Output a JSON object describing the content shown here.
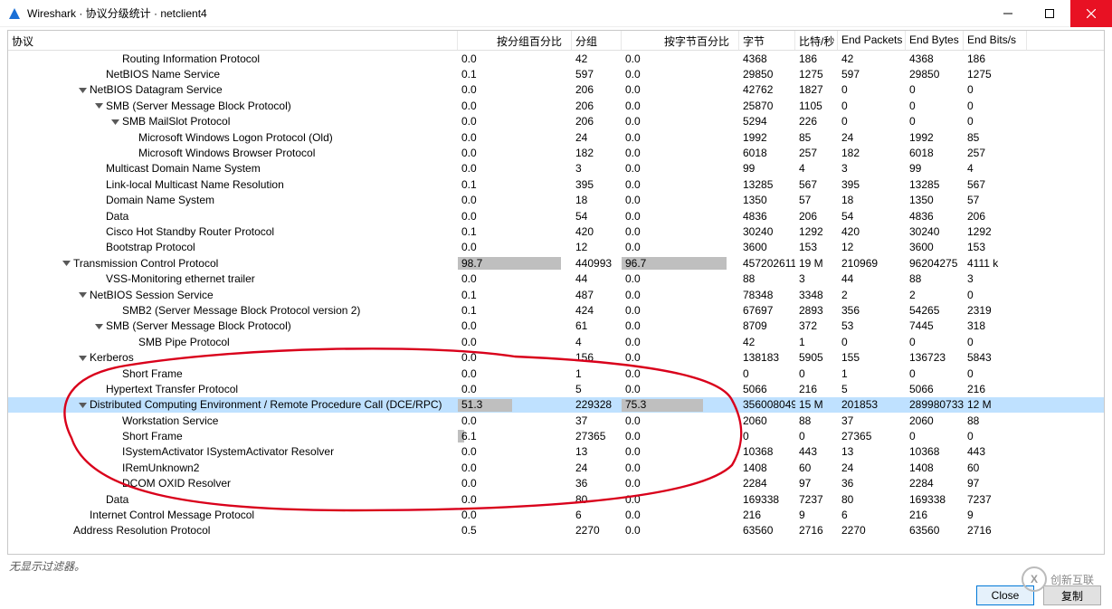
{
  "window": {
    "title": "Wireshark · 协议分级统计 · netclient4"
  },
  "headers": {
    "protocol": "协议",
    "pct_packets": "按分组百分比",
    "packets": "分组",
    "pct_bytes": "按字节百分比",
    "bytes": "字节",
    "bits_s": "比特/秒",
    "end_packets": "End Packets",
    "end_bytes": "End Bytes",
    "end_bits_s": "End Bits/s"
  },
  "rows": [
    {
      "indent": 6,
      "exp": "",
      "name": "Routing Information Protocol",
      "pp": "0.0",
      "pk": "42",
      "pb": "0.0",
      "by": "4368",
      "bs": "186",
      "ep": "42",
      "eb": "4368",
      "ebs": "186"
    },
    {
      "indent": 5,
      "exp": "",
      "name": "NetBIOS Name Service",
      "pp": "0.1",
      "pk": "597",
      "pb": "0.0",
      "by": "29850",
      "bs": "1275",
      "ep": "597",
      "eb": "29850",
      "ebs": "1275"
    },
    {
      "indent": 4,
      "exp": "v",
      "name": "NetBIOS Datagram Service",
      "pp": "0.0",
      "pk": "206",
      "pb": "0.0",
      "by": "42762",
      "bs": "1827",
      "ep": "0",
      "eb": "0",
      "ebs": "0"
    },
    {
      "indent": 5,
      "exp": "v",
      "name": "SMB (Server Message Block Protocol)",
      "pp": "0.0",
      "pk": "206",
      "pb": "0.0",
      "by": "25870",
      "bs": "1105",
      "ep": "0",
      "eb": "0",
      "ebs": "0"
    },
    {
      "indent": 6,
      "exp": "v",
      "name": "SMB MailSlot Protocol",
      "pp": "0.0",
      "pk": "206",
      "pb": "0.0",
      "by": "5294",
      "bs": "226",
      "ep": "0",
      "eb": "0",
      "ebs": "0"
    },
    {
      "indent": 7,
      "exp": "",
      "name": "Microsoft Windows Logon Protocol (Old)",
      "pp": "0.0",
      "pk": "24",
      "pb": "0.0",
      "by": "1992",
      "bs": "85",
      "ep": "24",
      "eb": "1992",
      "ebs": "85"
    },
    {
      "indent": 7,
      "exp": "",
      "name": "Microsoft Windows Browser Protocol",
      "pp": "0.0",
      "pk": "182",
      "pb": "0.0",
      "by": "6018",
      "bs": "257",
      "ep": "182",
      "eb": "6018",
      "ebs": "257"
    },
    {
      "indent": 5,
      "exp": "",
      "name": "Multicast Domain Name System",
      "pp": "0.0",
      "pk": "3",
      "pb": "0.0",
      "by": "99",
      "bs": "4",
      "ep": "3",
      "eb": "99",
      "ebs": "4"
    },
    {
      "indent": 5,
      "exp": "",
      "name": "Link-local Multicast Name Resolution",
      "pp": "0.1",
      "pk": "395",
      "pb": "0.0",
      "by": "13285",
      "bs": "567",
      "ep": "395",
      "eb": "13285",
      "ebs": "567"
    },
    {
      "indent": 5,
      "exp": "",
      "name": "Domain Name System",
      "pp": "0.0",
      "pk": "18",
      "pb": "0.0",
      "by": "1350",
      "bs": "57",
      "ep": "18",
      "eb": "1350",
      "ebs": "57"
    },
    {
      "indent": 5,
      "exp": "",
      "name": "Data",
      "pp": "0.0",
      "pk": "54",
      "pb": "0.0",
      "by": "4836",
      "bs": "206",
      "ep": "54",
      "eb": "4836",
      "ebs": "206"
    },
    {
      "indent": 5,
      "exp": "",
      "name": "Cisco Hot Standby Router Protocol",
      "pp": "0.1",
      "pk": "420",
      "pb": "0.0",
      "by": "30240",
      "bs": "1292",
      "ep": "420",
      "eb": "30240",
      "ebs": "1292"
    },
    {
      "indent": 5,
      "exp": "",
      "name": "Bootstrap Protocol",
      "pp": "0.0",
      "pk": "12",
      "pb": "0.0",
      "by": "3600",
      "bs": "153",
      "ep": "12",
      "eb": "3600",
      "ebs": "153"
    },
    {
      "indent": 3,
      "exp": "v",
      "name": "Transmission Control Protocol",
      "pp": "98.7",
      "pk": "440993",
      "pb": "96.7",
      "by": "457202611",
      "bs": "19 M",
      "ep": "210969",
      "eb": "96204275",
      "ebs": "4111 k",
      "bar_pp": 98.7,
      "bar_pb": 96.7
    },
    {
      "indent": 5,
      "exp": "",
      "name": "VSS-Monitoring ethernet trailer",
      "pp": "0.0",
      "pk": "44",
      "pb": "0.0",
      "by": "88",
      "bs": "3",
      "ep": "44",
      "eb": "88",
      "ebs": "3"
    },
    {
      "indent": 4,
      "exp": "v",
      "name": "NetBIOS Session Service",
      "pp": "0.1",
      "pk": "487",
      "pb": "0.0",
      "by": "78348",
      "bs": "3348",
      "ep": "2",
      "eb": "2",
      "ebs": "0"
    },
    {
      "indent": 6,
      "exp": "",
      "name": "SMB2 (Server Message Block Protocol version 2)",
      "pp": "0.1",
      "pk": "424",
      "pb": "0.0",
      "by": "67697",
      "bs": "2893",
      "ep": "356",
      "eb": "54265",
      "ebs": "2319"
    },
    {
      "indent": 5,
      "exp": "v",
      "name": "SMB (Server Message Block Protocol)",
      "pp": "0.0",
      "pk": "61",
      "pb": "0.0",
      "by": "8709",
      "bs": "372",
      "ep": "53",
      "eb": "7445",
      "ebs": "318"
    },
    {
      "indent": 7,
      "exp": "",
      "name": "SMB Pipe Protocol",
      "pp": "0.0",
      "pk": "4",
      "pb": "0.0",
      "by": "42",
      "bs": "1",
      "ep": "0",
      "eb": "0",
      "ebs": "0"
    },
    {
      "indent": 4,
      "exp": "v",
      "name": "Kerberos",
      "pp": "0.0",
      "pk": "156",
      "pb": "0.0",
      "by": "138183",
      "bs": "5905",
      "ep": "155",
      "eb": "136723",
      "ebs": "5843"
    },
    {
      "indent": 6,
      "exp": "",
      "name": "Short Frame",
      "pp": "0.0",
      "pk": "1",
      "pb": "0.0",
      "by": "0",
      "bs": "0",
      "ep": "1",
      "eb": "0",
      "ebs": "0"
    },
    {
      "indent": 5,
      "exp": "",
      "name": "Hypertext Transfer Protocol",
      "pp": "0.0",
      "pk": "5",
      "pb": "0.0",
      "by": "5066",
      "bs": "216",
      "ep": "5",
      "eb": "5066",
      "ebs": "216"
    },
    {
      "indent": 4,
      "exp": "v",
      "name": "Distributed Computing Environment / Remote Procedure Call (DCE/RPC)",
      "pp": "51.3",
      "pk": "229328",
      "pb": "75.3",
      "by": "356008049",
      "bs": "15 M",
      "ep": "201853",
      "eb": "289980733",
      "ebs": "12 M",
      "selected": true,
      "bar_pp": 51.3,
      "bar_pb": 75.3
    },
    {
      "indent": 6,
      "exp": "",
      "name": "Workstation Service",
      "pp": "0.0",
      "pk": "37",
      "pb": "0.0",
      "by": "2060",
      "bs": "88",
      "ep": "37",
      "eb": "2060",
      "ebs": "88"
    },
    {
      "indent": 6,
      "exp": "",
      "name": "Short Frame",
      "pp": "6.1",
      "pk": "27365",
      "pb": "0.0",
      "by": "0",
      "bs": "0",
      "ep": "27365",
      "eb": "0",
      "ebs": "0",
      "bar_pp": 6.1
    },
    {
      "indent": 6,
      "exp": "",
      "name": "ISystemActivator ISystemActivator Resolver",
      "pp": "0.0",
      "pk": "13",
      "pb": "0.0",
      "by": "10368",
      "bs": "443",
      "ep": "13",
      "eb": "10368",
      "ebs": "443"
    },
    {
      "indent": 6,
      "exp": "",
      "name": "IRemUnknown2",
      "pp": "0.0",
      "pk": "24",
      "pb": "0.0",
      "by": "1408",
      "bs": "60",
      "ep": "24",
      "eb": "1408",
      "ebs": "60"
    },
    {
      "indent": 6,
      "exp": "",
      "name": "DCOM OXID Resolver",
      "pp": "0.0",
      "pk": "36",
      "pb": "0.0",
      "by": "2284",
      "bs": "97",
      "ep": "36",
      "eb": "2284",
      "ebs": "97"
    },
    {
      "indent": 5,
      "exp": "",
      "name": "Data",
      "pp": "0.0",
      "pk": "80",
      "pb": "0.0",
      "by": "169338",
      "bs": "7237",
      "ep": "80",
      "eb": "169338",
      "ebs": "7237"
    },
    {
      "indent": 4,
      "exp": "",
      "name": "Internet Control Message Protocol",
      "pp": "0.0",
      "pk": "6",
      "pb": "0.0",
      "by": "216",
      "bs": "9",
      "ep": "6",
      "eb": "216",
      "ebs": "9"
    },
    {
      "indent": 3,
      "exp": "",
      "name": "Address Resolution Protocol",
      "pp": "0.5",
      "pk": "2270",
      "pb": "0.0",
      "by": "63560",
      "bs": "2716",
      "ep": "2270",
      "eb": "63560",
      "ebs": "2716"
    }
  ],
  "status": "无显示过滤器。",
  "buttons": {
    "close": "Close",
    "copy": "复制"
  },
  "watermark": "创新互联"
}
